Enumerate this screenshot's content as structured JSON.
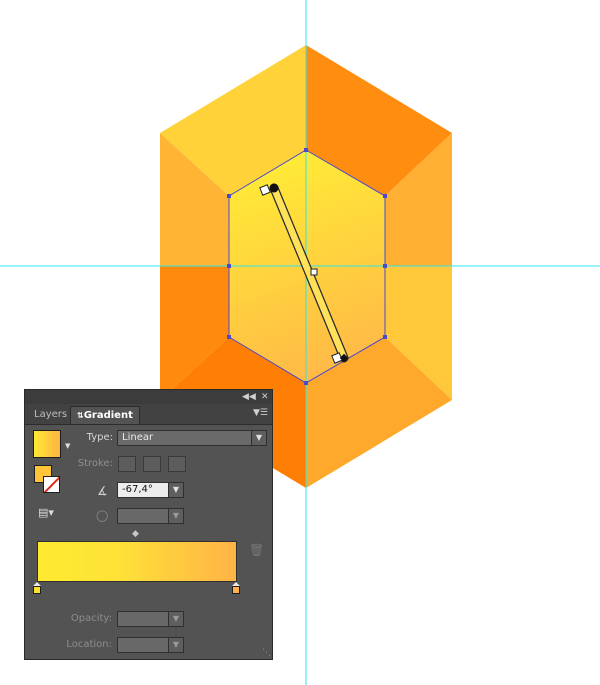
{
  "panel": {
    "tabs": [
      "Layers",
      "Gradient"
    ],
    "active_tab": "Gradient",
    "type_label": "Type:",
    "type_value": "Linear",
    "stroke_label": "Stroke:",
    "angle_value": "-67,4°",
    "opacity_label": "Opacity:",
    "location_label": "Location:",
    "collapse_icon": "double-chevron-left-icon",
    "close_icon": "close-icon",
    "menu_icon": "panel-menu-icon"
  },
  "colors": {
    "gem_top_left": "#ffd23a",
    "gem_top_right": "#ff8d10",
    "gem_right_upper": "#ffb033",
    "gem_right_lower": "#ffc83a",
    "gem_bottom_right": "#ffa92c",
    "gem_bottom_left": "#ff7f05",
    "gem_left_lower": "#ff8a0b",
    "gem_left_upper": "#ffb533",
    "gradient_start": "#ffea30",
    "gradient_end": "#ffb347",
    "guide_line": "#2ee6ee",
    "selection": "#4a4acf",
    "panel_bg": "#535353"
  }
}
